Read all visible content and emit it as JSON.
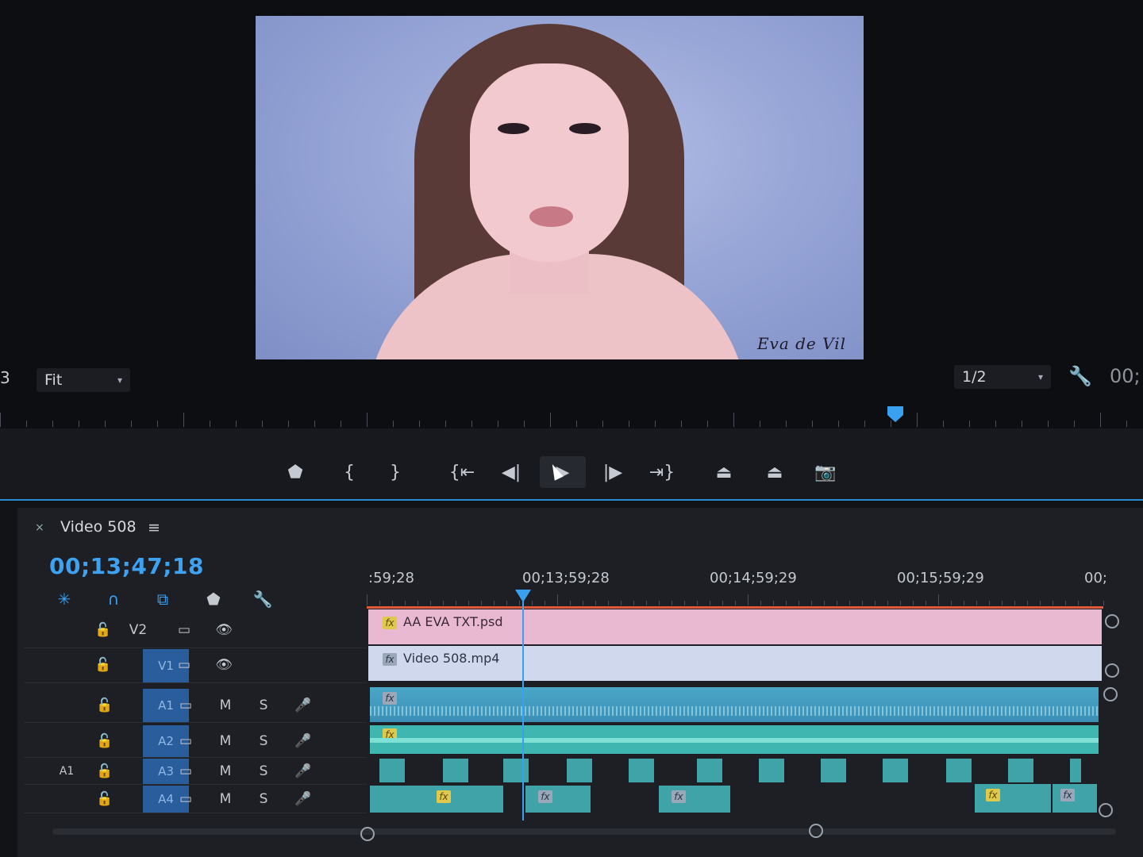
{
  "monitor": {
    "watermark": "Eva de Vil",
    "zoom_select": "Fit",
    "resolution_select": "1/2",
    "timecode_partial": "00;",
    "left_edge_char": "3"
  },
  "transport": {
    "buttons": [
      {
        "name": "add-marker-button",
        "glyph": "⬟"
      },
      {
        "name": "mark-in-button",
        "glyph": "{"
      },
      {
        "name": "mark-out-button",
        "glyph": "}"
      },
      {
        "name": "go-to-in-button",
        "glyph": "{⇤"
      },
      {
        "name": "step-back-button",
        "glyph": "◀|"
      },
      {
        "name": "play-button",
        "glyph": "▶"
      },
      {
        "name": "step-forward-button",
        "glyph": "|▶"
      },
      {
        "name": "go-to-out-button",
        "glyph": "⇥}"
      },
      {
        "name": "lift-button",
        "glyph": "⏏"
      },
      {
        "name": "extract-button",
        "glyph": "⏏"
      },
      {
        "name": "export-frame-button",
        "glyph": "📷"
      }
    ]
  },
  "sequence": {
    "close": "×",
    "title": "Video 508",
    "menu": "≡",
    "timecode": "00;13;47;18"
  },
  "ruler": {
    "labels": [
      ":59;28",
      "00;13;59;28",
      "00;14;59;29",
      "00;15;59;29",
      "00;"
    ]
  },
  "tracks": {
    "video": [
      {
        "name": "V2",
        "lock": "🔓",
        "toggle": "▭",
        "eye": "👁",
        "targeted": false
      },
      {
        "name": "V1",
        "lock": "🔓",
        "toggle": "▭",
        "eye": "👁",
        "targeted": true
      }
    ],
    "audio": [
      {
        "name": "A1",
        "source": "",
        "lock": "🔓",
        "toggle": "▭",
        "m": "M",
        "s": "S",
        "mic": "🎤"
      },
      {
        "name": "A2",
        "source": "",
        "lock": "🔓",
        "toggle": "▭",
        "m": "M",
        "s": "S",
        "mic": "🎤"
      },
      {
        "name": "A3",
        "source": "A1",
        "lock": "🔓",
        "toggle": "▭",
        "m": "M",
        "s": "S",
        "mic": "🎤"
      },
      {
        "name": "A4",
        "source": "",
        "lock": "🔓",
        "toggle": "▭",
        "m": "M",
        "s": "S",
        "mic": "🎤"
      }
    ]
  },
  "clips": {
    "v2_clip": "AA EVA TXT.psd",
    "v1_clip": "Video 508.mp4",
    "fx_label": "fx"
  },
  "colors": {
    "accent": "#3aa0f0",
    "v2_clip": "#e9b9d2",
    "v1_clip": "#cfd8ec",
    "audio_clip": "#3fa3a8"
  }
}
